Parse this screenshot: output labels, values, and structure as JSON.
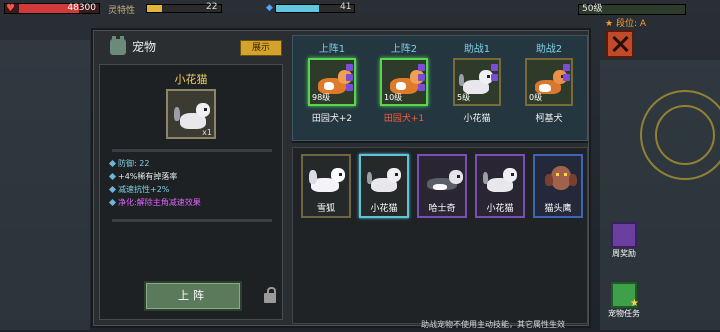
{
  "hud": {
    "hp_value": "48300",
    "trait_label": "灵特性",
    "trait_value": "22",
    "energy_value": "41",
    "level_value": "50级",
    "rank_label": "段位: A"
  },
  "panel": {
    "title": "宠物",
    "preview_label": "展示"
  },
  "detail": {
    "pet_name": "小花猫",
    "count": "x1",
    "stats": [
      {
        "text": "防御: 22",
        "color": "#7fd0e6"
      },
      {
        "text": "+4%稀有掉落率",
        "color": "#e8e8e8"
      },
      {
        "text": "减速抗性+2%",
        "color": "#7fd0e6"
      },
      {
        "text": "净化:解除主角减速效果",
        "color": "#e060ff"
      }
    ],
    "deploy_label": "上阵"
  },
  "slots": [
    {
      "label": "上阵1",
      "level": "98级",
      "name": "田园犬+2",
      "name_color": "normal",
      "active": true,
      "pet": "dog"
    },
    {
      "label": "上阵2",
      "level": "10级",
      "name": "田园犬+1",
      "name_color": "red",
      "active": true,
      "pet": "dog"
    },
    {
      "label": "助战1",
      "level": "5级",
      "name": "小花猫",
      "name_color": "normal",
      "active": false,
      "pet": "cat"
    },
    {
      "label": "助战2",
      "level": "0级",
      "name": "柯基犬",
      "name_color": "normal",
      "active": false,
      "pet": "corgi"
    }
  ],
  "pets": [
    {
      "name": "雪狐",
      "rarity": "gold",
      "pet": "fox"
    },
    {
      "name": "小花猫",
      "rarity": "selected",
      "pet": "cat"
    },
    {
      "name": "哈士奇",
      "rarity": "purple",
      "pet": "husky"
    },
    {
      "name": "小花猫",
      "rarity": "purple",
      "pet": "cat"
    },
    {
      "name": "猫头鹰",
      "rarity": "blue",
      "pet": "owl"
    }
  ],
  "side": {
    "weekly_label": "周奖励",
    "task_label": "宠物任务"
  },
  "footer_note": "助战宠物不使用主动技能，其它属性生效",
  "colors": {
    "accent_gold": "#d4a32c",
    "active_green": "#58d650",
    "slot_label": "#7fd0e6",
    "close_red": "#c04a2a"
  }
}
